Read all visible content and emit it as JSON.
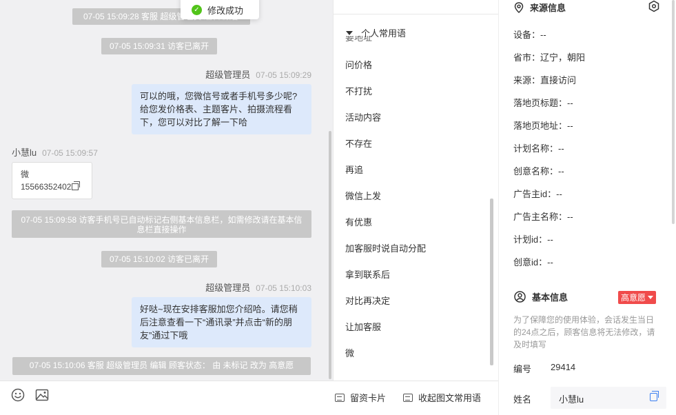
{
  "toast": {
    "text": "修改成功"
  },
  "chat": {
    "sys_top": "07-05 15:09:28 客服 超级管理员 编辑 顾客",
    "sys_leave1": "07-05 15:09:31 访客已离开",
    "agent1": {
      "name": "超级管理员",
      "time": "07-05 15:09:29",
      "message": "可以的哦，您微信号或者手机号多少呢?给您发价格表、主题客片、拍摄流程看下，您可以对比了解一下哈"
    },
    "visitor1": {
      "name": "小慧lu",
      "time": "07-05 15:09:57",
      "card_line1": "微",
      "card_line2": "15566352402"
    },
    "sys_phone": "07-05 15:09:58 访客手机号已自动标记右侧基本信息栏，如需修改请在基本信息栏直接操作",
    "sys_leave2": "07-05 15:10:02 访客已离开",
    "agent2": {
      "name": "超级管理员",
      "time": "07-05 15:10:03",
      "message": "好哒~现在安排客服加您介绍哈。请您稍后注意查看一下“通讯录”并点击“新的朋友”通过下哦"
    },
    "sys_status": "07-05 15:10:06 客服 超级管理员 编辑 顾客状态： 由 未标记 改为 高意愿"
  },
  "toolbar": {
    "emoji_icon": "smile-icon",
    "image_icon": "image-icon",
    "card_button": "留资卡片",
    "collapse_button": "收起图文常用语"
  },
  "phrases": {
    "group_title": "个人常用语",
    "ghost_item": "要地址",
    "items": [
      "问价格",
      "不打扰",
      "活动内容",
      "不存在",
      "再追",
      "微信上发",
      "有优惠",
      "加客服时说自动分配",
      "拿到联系后",
      "对比再决定",
      "让加客服",
      "微"
    ]
  },
  "info": {
    "source_title": "来源信息",
    "source_fields": [
      "设备：--",
      "省市：辽宁，朝阳",
      "来源：直接访问",
      "落地页标题：--",
      "落地页地址：--",
      "计划名称：--",
      "创意名称：--",
      "广告主id：--",
      "广告主名称：--",
      "计划id：--",
      "创意id：--"
    ],
    "basic_title": "基本信息",
    "intent_tag": "高意愿",
    "notice": "为了保障您的使用体验，会话发生当日的24点之后，顾客信息将无法修改，请及时填写",
    "id_label": "编号",
    "id_value": "29414",
    "name_label": "姓名",
    "name_value": "小慧lu",
    "accent_color": "#3a7ef0",
    "tag_color": "#f04b4b"
  }
}
